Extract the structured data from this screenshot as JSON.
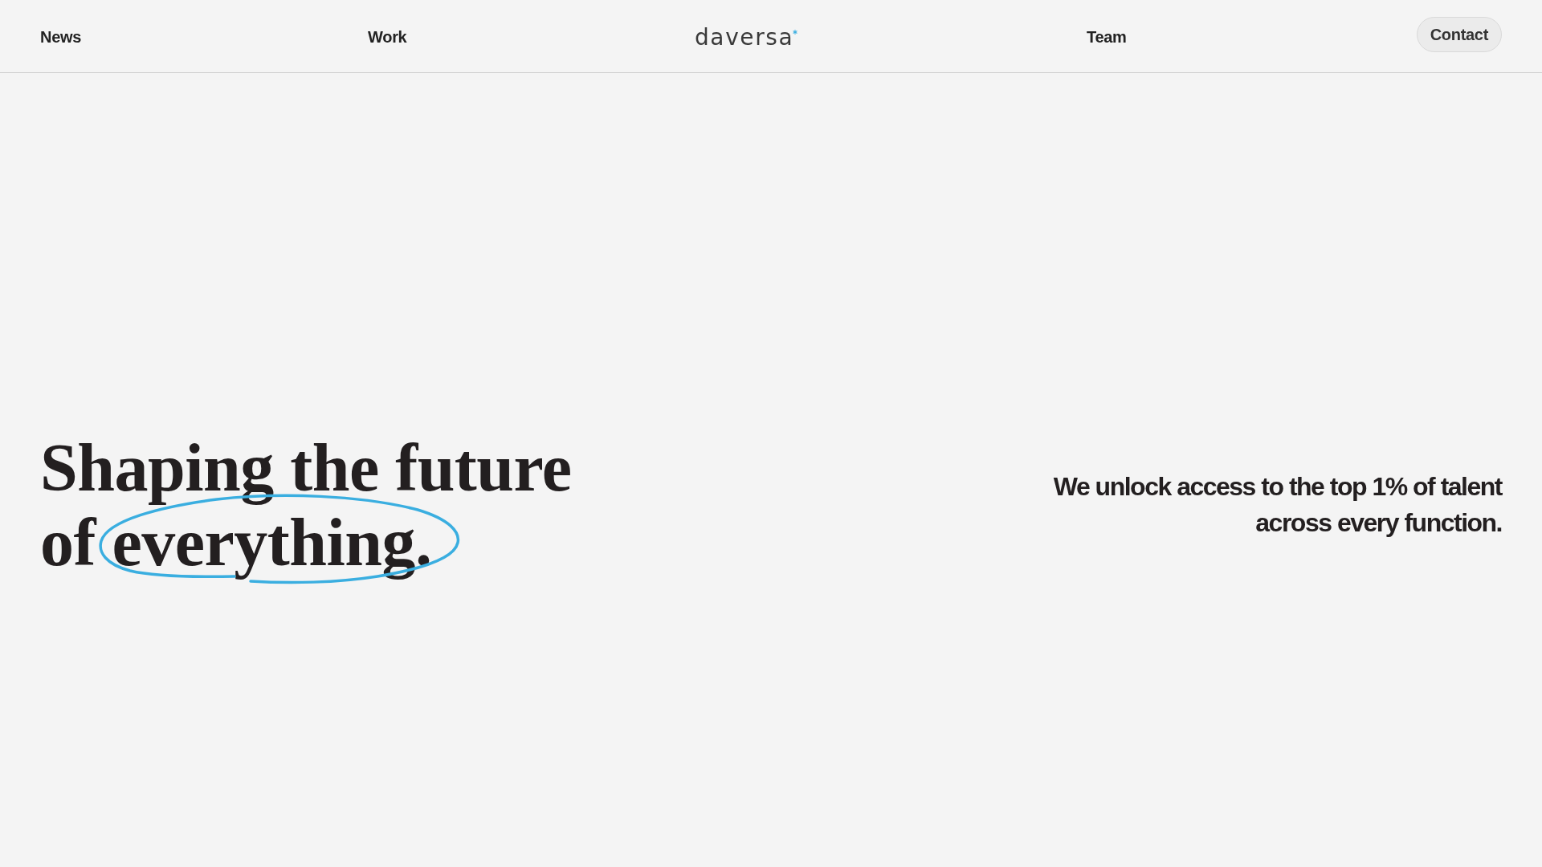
{
  "header": {
    "nav_left": [
      "News",
      "Work"
    ],
    "logo": "daversa",
    "nav_right": [
      "Team"
    ],
    "contact_button": "Contact"
  },
  "hero": {
    "headline": {
      "lines": [
        "Shaping the future",
        "of everything."
      ],
      "circled": true
    },
    "tagline": "We unlock access to the top 1% of talent across every function."
  }
}
